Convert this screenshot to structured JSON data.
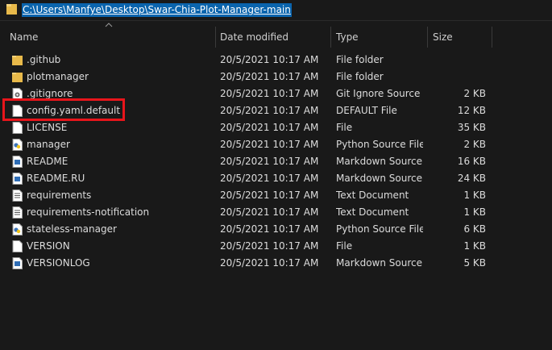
{
  "address": {
    "path": "C:\\Users\\Manfye\\Desktop\\Swar-Chia-Plot-Manager-main"
  },
  "columns": {
    "name": "Name",
    "date_modified": "Date modified",
    "type": "Type",
    "size": "Size"
  },
  "files": [
    {
      "name": ".github",
      "date": "20/5/2021 10:17 AM",
      "type": "File folder",
      "size": "",
      "icon": "folder-icon"
    },
    {
      "name": "plotmanager",
      "date": "20/5/2021 10:17 AM",
      "type": "File folder",
      "size": "",
      "icon": "folder-icon"
    },
    {
      "name": ".gitignore",
      "date": "20/5/2021 10:17 AM",
      "type": "Git Ignore Source ...",
      "size": "2 KB",
      "icon": "source-file-icon"
    },
    {
      "name": "config.yaml.default",
      "date": "20/5/2021 10:17 AM",
      "type": "DEFAULT File",
      "size": "12 KB",
      "icon": "file-icon"
    },
    {
      "name": "LICENSE",
      "date": "20/5/2021 10:17 AM",
      "type": "File",
      "size": "35 KB",
      "icon": "file-icon"
    },
    {
      "name": "manager",
      "date": "20/5/2021 10:17 AM",
      "type": "Python Source File",
      "size": "2 KB",
      "icon": "python-file-icon"
    },
    {
      "name": "README",
      "date": "20/5/2021 10:17 AM",
      "type": "Markdown Source...",
      "size": "16 KB",
      "icon": "markdown-file-icon"
    },
    {
      "name": "README.RU",
      "date": "20/5/2021 10:17 AM",
      "type": "Markdown Source...",
      "size": "24 KB",
      "icon": "markdown-file-icon"
    },
    {
      "name": "requirements",
      "date": "20/5/2021 10:17 AM",
      "type": "Text Document",
      "size": "1 KB",
      "icon": "text-file-icon"
    },
    {
      "name": "requirements-notification",
      "date": "20/5/2021 10:17 AM",
      "type": "Text Document",
      "size": "1 KB",
      "icon": "text-file-icon"
    },
    {
      "name": "stateless-manager",
      "date": "20/5/2021 10:17 AM",
      "type": "Python Source File",
      "size": "6 KB",
      "icon": "python-file-icon"
    },
    {
      "name": "VERSION",
      "date": "20/5/2021 10:17 AM",
      "type": "File",
      "size": "1 KB",
      "icon": "file-icon"
    },
    {
      "name": "VERSIONLOG",
      "date": "20/5/2021 10:17 AM",
      "type": "Markdown Source...",
      "size": "5 KB",
      "icon": "markdown-file-icon"
    }
  ],
  "colors": {
    "background": "#191919",
    "selection": "#0a64ad",
    "highlight_box": "#e8151b",
    "folder": "#e8b94a"
  }
}
